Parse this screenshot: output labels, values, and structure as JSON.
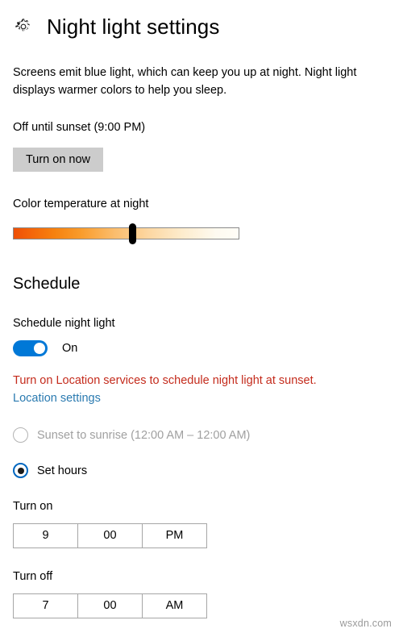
{
  "header": {
    "icon": "gear-icon",
    "title": "Night light settings"
  },
  "description": "Screens emit blue light, which can keep you up at night. Night light displays warmer colors to help you sleep.",
  "status": {
    "text": "Off until sunset (9:00 PM)",
    "button_label": "Turn on now"
  },
  "slider": {
    "label": "Color temperature at night",
    "value_percent": 52,
    "gradient_start": "#ee4f06",
    "gradient_end": "#fffdf7",
    "thumb_color": "#000000"
  },
  "schedule": {
    "heading": "Schedule",
    "toggle_label": "Schedule night light",
    "toggle_state": "On",
    "toggle_on": true,
    "accent_color": "#0078d7",
    "warning_text": "Turn on Location services to schedule night light at sunset.",
    "warning_color": "#c42b1c",
    "location_link": "Location settings",
    "link_color": "#2a7ab0",
    "options": [
      {
        "label": "Sunset to sunrise (12:00 AM – 12:00 AM)",
        "selected": false,
        "disabled": true
      },
      {
        "label": "Set hours",
        "selected": true,
        "disabled": false
      }
    ],
    "turn_on": {
      "label": "Turn on",
      "hour": "9",
      "minute": "00",
      "meridiem": "PM"
    },
    "turn_off": {
      "label": "Turn off",
      "hour": "7",
      "minute": "00",
      "meridiem": "AM"
    }
  },
  "watermark": "wsxdn.com"
}
